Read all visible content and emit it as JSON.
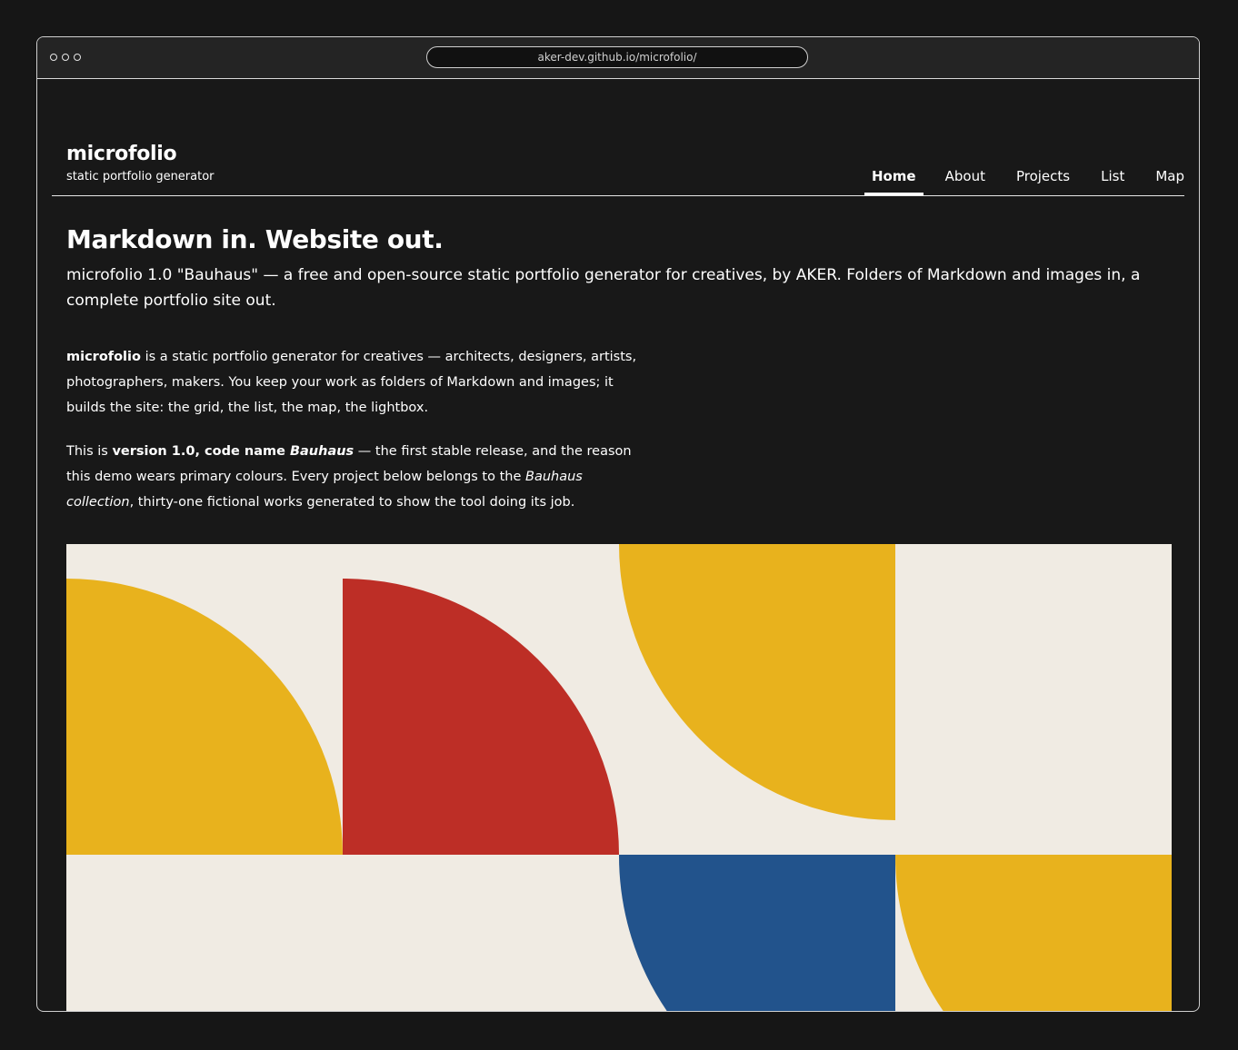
{
  "browser": {
    "url": "aker-dev.github.io/microfolio/"
  },
  "site": {
    "title": "microfolio",
    "subtitle": "static portfolio generator"
  },
  "nav": {
    "items": [
      {
        "label": "Home",
        "active": true
      },
      {
        "label": "About",
        "active": false
      },
      {
        "label": "Projects",
        "active": false
      },
      {
        "label": "List",
        "active": false
      },
      {
        "label": "Map",
        "active": false
      }
    ]
  },
  "hero": {
    "heading": "Markdown in. Website out.",
    "lead": "microfolio 1.0 \"Bauhaus\" — a free and open-source static portfolio generator for creatives, by AKER. Folders of Markdown and images in, a complete portfolio site out."
  },
  "intro": {
    "p1_bold": "microfolio",
    "p1_rest": " is a static portfolio generator for creatives — architects, designers, artists, photographers, makers. You keep your work as folders of Markdown and images; it builds the site: the grid, the list, the map, the lightbox.",
    "p2_a": "This is ",
    "p2_bold": "version 1.0, code name ",
    "p2_bold_italic": "Bauhaus",
    "p2_b": " — the first stable release, and the reason this demo wears primary colours. Every project below belongs to the ",
    "p2_italic": "Bauhaus collection",
    "p2_c": ", thirty-one fictional works generated to show the tool doing its job."
  },
  "colors": {
    "background": "#181818",
    "cream": "#f0ebe3",
    "yellow": "#e8b21d",
    "red": "#bd2e26",
    "blue": "#22538c"
  },
  "icons": [
    "window-dot-icon"
  ]
}
